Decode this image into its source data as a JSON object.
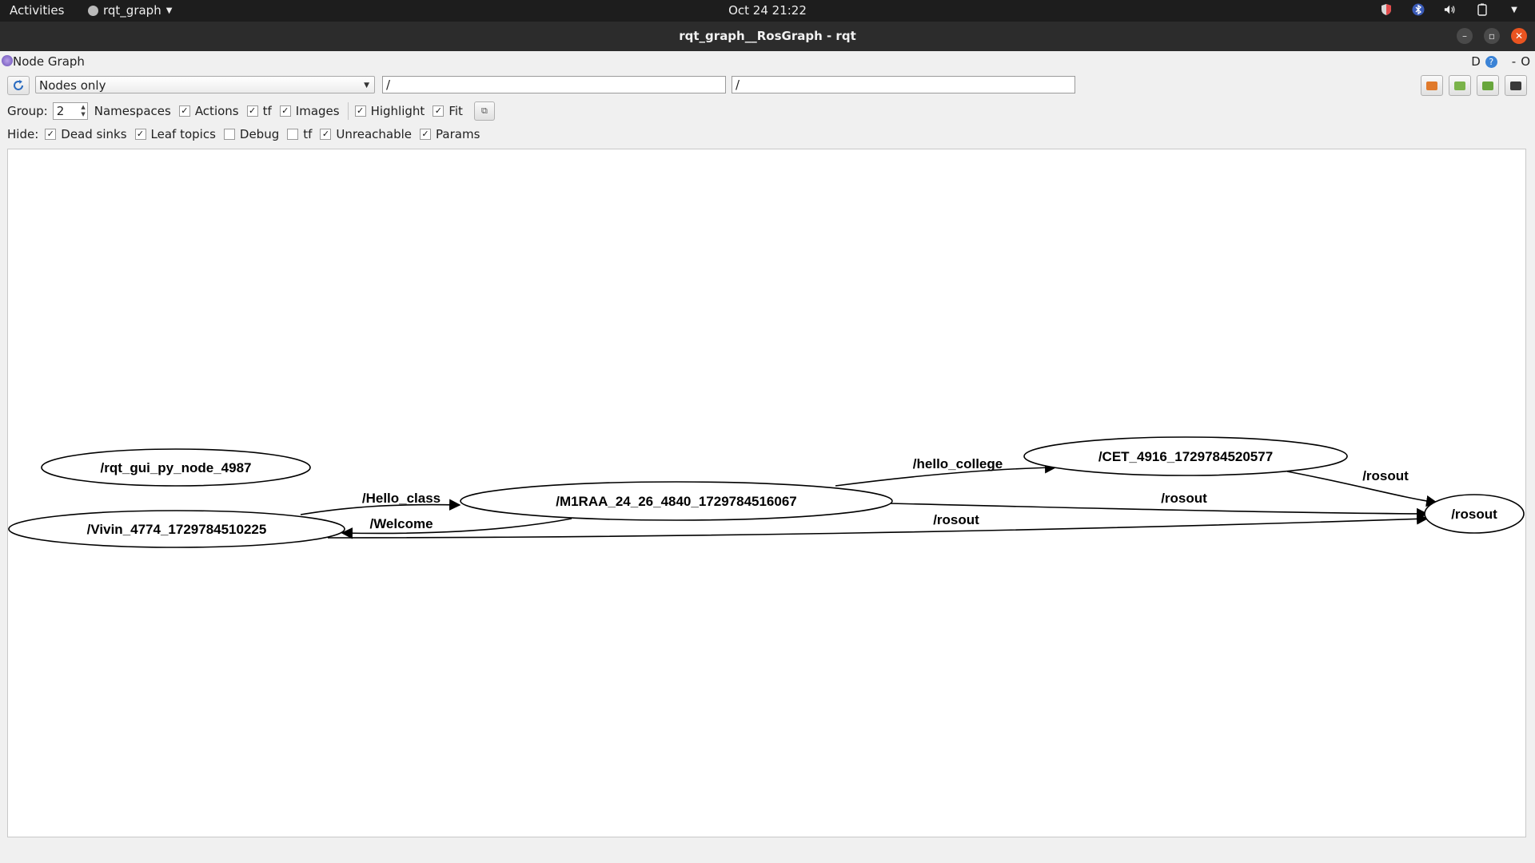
{
  "topbar": {
    "activities": "Activities",
    "app_menu": "rqt_graph",
    "clock": "Oct 24  21:22"
  },
  "window": {
    "title": "rqt_graph__RosGraph - rqt",
    "minimize": "–",
    "maximize": "▫",
    "close": "✕"
  },
  "plugin": {
    "title": "Node Graph",
    "right_label_d": "D",
    "right_label_help": "?",
    "right_dash": "-",
    "right_o": "O"
  },
  "toolbar": {
    "mode": "Nodes only",
    "node_filter": "/",
    "topic_filter": "/"
  },
  "group_row": {
    "group_label": "Group:",
    "group_value": "2",
    "namespaces_label": "Namespaces",
    "actions": {
      "label": "Actions",
      "checked": true
    },
    "tf": {
      "label": "tf",
      "checked": true
    },
    "images": {
      "label": "Images",
      "checked": true
    },
    "highlight": {
      "label": "Highlight",
      "checked": true
    },
    "fit": {
      "label": "Fit",
      "checked": true
    }
  },
  "hide_row": {
    "hide_label": "Hide:",
    "dead_sinks": {
      "label": "Dead sinks",
      "checked": true
    },
    "leaf_topics": {
      "label": "Leaf topics",
      "checked": true
    },
    "debug": {
      "label": "Debug",
      "checked": false
    },
    "tf": {
      "label": "tf",
      "checked": false
    },
    "unreachable": {
      "label": "Unreachable",
      "checked": true
    },
    "params": {
      "label": "Params",
      "checked": true
    }
  },
  "graph": {
    "nodes": [
      {
        "id": "rqt",
        "label": "/rqt_gui_py_node_4987"
      },
      {
        "id": "vivin",
        "label": "/Vivin_4774_1729784510225"
      },
      {
        "id": "m1raa",
        "label": "/M1RAA_24_26_4840_1729784516067"
      },
      {
        "id": "cet",
        "label": "/CET_4916_1729784520577"
      },
      {
        "id": "rosout",
        "label": "/rosout"
      }
    ],
    "edges": [
      {
        "from": "vivin",
        "to": "m1raa",
        "label": "/Hello_class"
      },
      {
        "from": "m1raa",
        "to": "vivin",
        "label": "/Welcome"
      },
      {
        "from": "m1raa",
        "to": "cet",
        "label": "/hello_college"
      },
      {
        "from": "cet",
        "to": "rosout",
        "label": "/rosout"
      },
      {
        "from": "m1raa",
        "to": "rosout",
        "label": "/rosout"
      },
      {
        "from": "vivin",
        "to": "rosout",
        "label": "/rosout"
      }
    ]
  }
}
